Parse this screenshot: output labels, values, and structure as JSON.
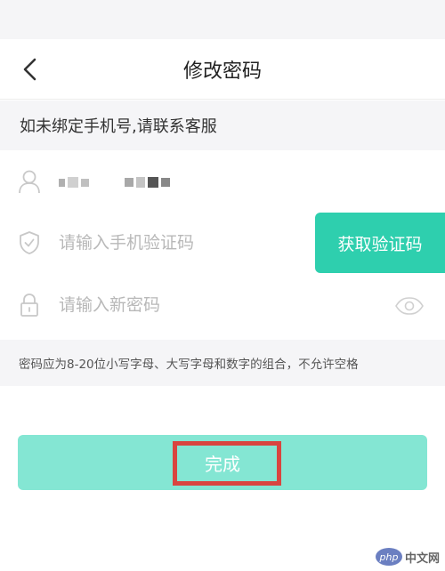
{
  "header": {
    "title": "修改密码",
    "back_icon": "chevron-left-icon"
  },
  "notice": {
    "text": "如未绑定手机号,请联系客服"
  },
  "account_row": {
    "icon": "user-icon"
  },
  "phone_code_row": {
    "icon": "shield-check-icon",
    "placeholder": "请输入手机验证码",
    "button_label": "获取验证码"
  },
  "password_row": {
    "icon": "lock-icon",
    "placeholder": "请输入新密码",
    "toggle_icon": "eye-icon"
  },
  "hint": {
    "text": "密码应为8-20位小写字母、大写字母和数字的组合，不允许空格"
  },
  "submit": {
    "label": "完成"
  },
  "watermark": {
    "logo": "php",
    "text": "中文网"
  },
  "colors": {
    "accent": "#2ecfae",
    "submit_disabled": "#84e6d3",
    "highlight": "#d9453f",
    "section_bg": "#f5f5f7"
  }
}
